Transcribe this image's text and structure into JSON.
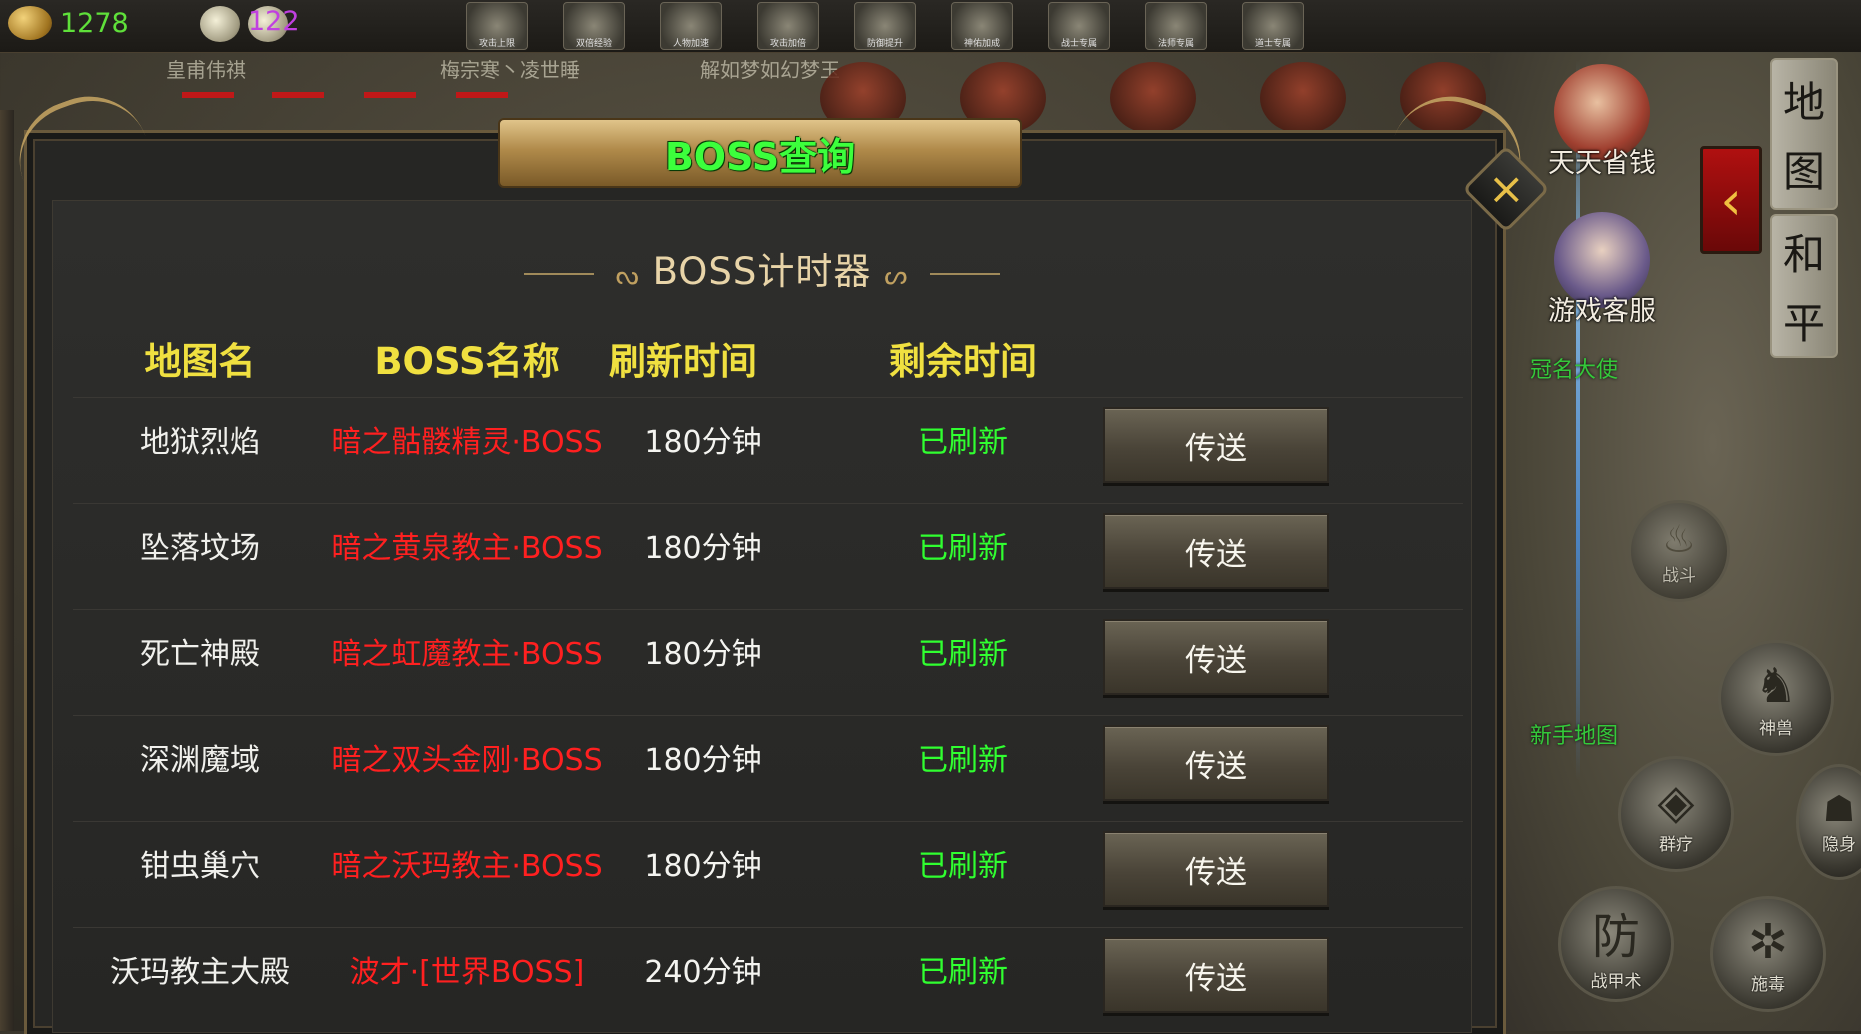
{
  "hud": {
    "gold": "1278",
    "gem": "122",
    "players": [
      "皇甫伟祺",
      "梅宗寒丶凌世睡",
      "解如梦如幻梦玉"
    ],
    "buffs": [
      "攻击上限",
      "双倍经验",
      "人物加速",
      "攻击加倍",
      "防御提升",
      "神佑加成",
      "战士专属",
      "法师专属",
      "道士专属"
    ]
  },
  "panel": {
    "title": "BOSS查询",
    "subtitle": "BOSS计时器",
    "close_icon": "×",
    "headers": {
      "map": "地图名",
      "boss": "BOSS名称",
      "refresh": "刷新时间",
      "remaining": "剩余时间"
    },
    "rows": [
      {
        "map": "地狱烈焰",
        "boss": "暗之骷髅精灵·BOSS",
        "refresh": "180分钟",
        "remaining": "已刷新",
        "action": "传送"
      },
      {
        "map": "坠落坟场",
        "boss": "暗之黄泉教主·BOSS",
        "refresh": "180分钟",
        "remaining": "已刷新",
        "action": "传送"
      },
      {
        "map": "死亡神殿",
        "boss": "暗之虹魔教主·BOSS",
        "refresh": "180分钟",
        "remaining": "已刷新",
        "action": "传送"
      },
      {
        "map": "深渊魔域",
        "boss": "暗之双头金刚·BOSS",
        "refresh": "180分钟",
        "remaining": "已刷新",
        "action": "传送"
      },
      {
        "map": "钳虫巢穴",
        "boss": "暗之沃玛教主·BOSS",
        "refresh": "180分钟",
        "remaining": "已刷新",
        "action": "传送"
      },
      {
        "map": "沃玛教主大殿",
        "boss": "波才·[世界BOSS]",
        "refresh": "240分钟",
        "remaining": "已刷新",
        "action": "传送"
      }
    ]
  },
  "side": {
    "save_money": "天天省钱",
    "customer_service": "游戏客服",
    "title_ambassador": "冠名大使",
    "newbie_map": "新手地图",
    "map_tab": [
      "地",
      "图"
    ],
    "peace_tab": [
      "和",
      "平"
    ],
    "arrow": "‹",
    "skills": {
      "battle": "战斗",
      "beast": "神兽",
      "group_heal": "群疗",
      "defense_glyph": "防",
      "defense": "战甲术",
      "poison": "施毒",
      "stealth": "隐身"
    }
  }
}
